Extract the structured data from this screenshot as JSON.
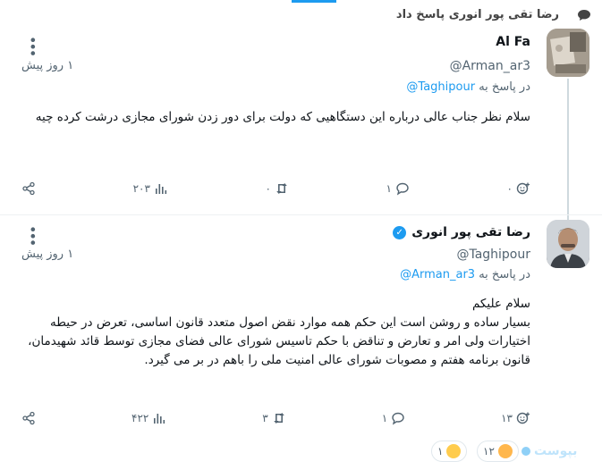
{
  "reply_header": {
    "text": "رضا تقی پور انوری پاسخ داد"
  },
  "tweet1": {
    "name": "Al Fa",
    "handle": "@Arman_ar3",
    "time": "۱ روز پیش",
    "in_reply_prefix": "در پاسخ به",
    "in_reply_mention": "@Taghipour",
    "body": "سلام نظر جناب عالی درباره این دستگاهیی که دولت برای دور زدن شورای مجازی درشت کرده چیه",
    "actions": {
      "views": "۲۰۳",
      "retweets": "۰",
      "replies": "۱",
      "likes": "۰"
    }
  },
  "tweet2": {
    "name": "رضا تقی پور انوری",
    "handle": "@Taghipour",
    "time": "۱ روز پیش",
    "in_reply_prefix": "در پاسخ به",
    "in_reply_mention": "@Arman_ar3",
    "body_line1": "سلام علیکم",
    "body_line2": "بسیار ساده و روشن است این حکم همه موارد نقض اصول متعدد قانون اساسی، تعرض در حیطه اختیارات ولی امر و تعارض و تناقض با حکم تاسیس شورای عالی فضای مجازی توسط قائد شهیدمان، قانون برنامه هفتم و مصوبات شورای عالی امنیت ملی را باهم در بر می گیرد.",
    "actions": {
      "views": "۴۲۲",
      "retweets": "۳",
      "replies": "۱",
      "likes": "۱۳"
    }
  },
  "bottom": {
    "brand": "بپوست",
    "reaction1_count": "۱۲",
    "reaction2_count": "۱"
  },
  "icons": {
    "reply_indicator": "speech-bubble-icon",
    "verified": "verified-badge-icon",
    "share": "share-icon",
    "views": "bar-chart-icon",
    "retweet": "retweet-icon",
    "reply": "reply-bubble-icon",
    "like": "add-reaction-icon"
  },
  "colors": {
    "accent": "#1d9bf0",
    "muted": "#536471",
    "text": "#0f1419"
  }
}
